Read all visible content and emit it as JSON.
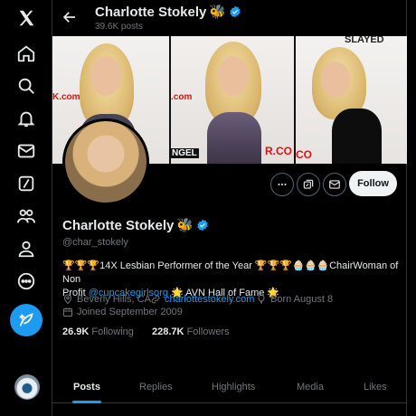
{
  "header": {
    "name": "Charlotte Stokely",
    "name_emoji": "🐝",
    "posts_count": "39.6K posts"
  },
  "nav": {
    "items": [
      "x-logo",
      "home",
      "explore",
      "notifications",
      "messages",
      "grok",
      "communities",
      "profile",
      "more"
    ]
  },
  "banner": {
    "watermarks": [
      "K.com",
      ".com",
      "SLAYED",
      "NGEL",
      "R.CO",
      "CO"
    ]
  },
  "profile": {
    "name": "Charlotte Stokely",
    "name_emoji": "🐝",
    "handle": "@char_stokely",
    "bio_line1_prefix": "🏆🏆🏆14X Lesbian Performer of the Year 🏆🏆🏆🧁🧁🧁ChairWoman of Non",
    "bio_line2_prefix": "Profit ",
    "bio_link": "@cupcakegirlsorg",
    "bio_line2_suffix": " 🌟 AVN Hall of Fame 🌟",
    "location": "Beverly Hills, CA",
    "website": "charlottestokely.com",
    "born": "Born August 8",
    "joined": "Joined September 2009",
    "following_count": "26.9K",
    "following_label": "Following",
    "followers_count": "228.7K",
    "followers_label": "Followers"
  },
  "actions": {
    "follow_label": "Follow"
  },
  "tabs": [
    "Posts",
    "Replies",
    "Highlights",
    "Media",
    "Likes"
  ],
  "colors": {
    "accent": "#1d9bf0",
    "background": "#000000",
    "muted": "#71767b"
  }
}
